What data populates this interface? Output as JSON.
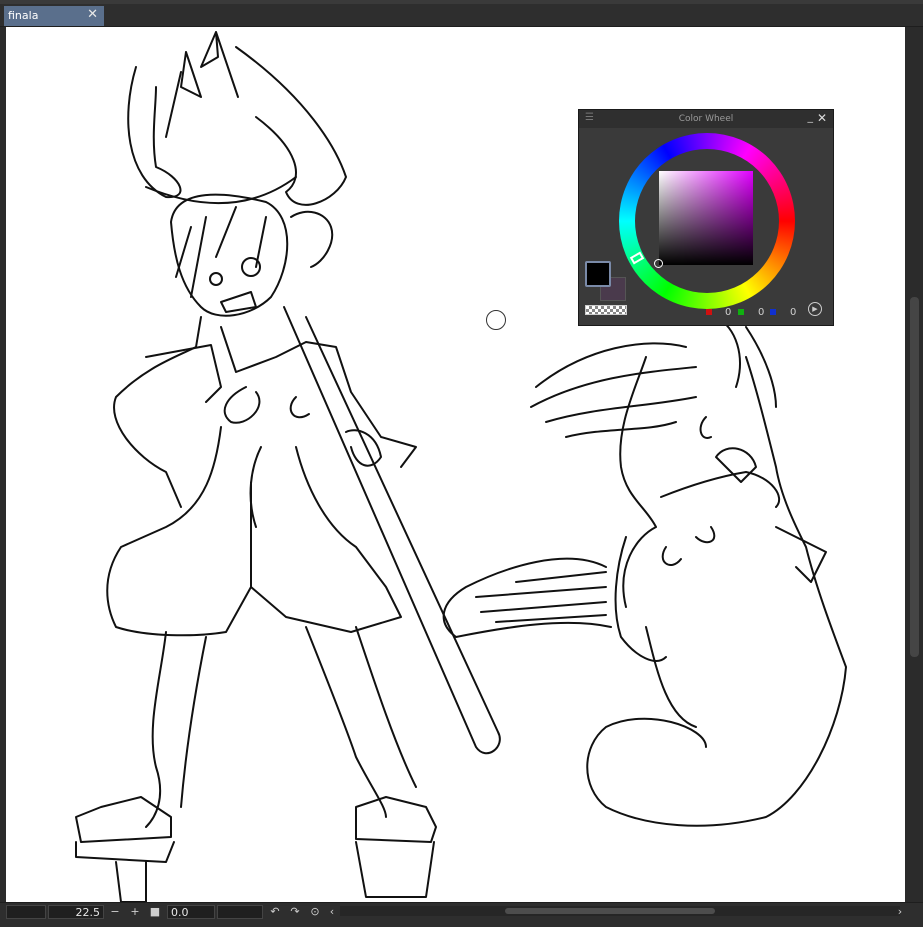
{
  "tab": {
    "title": "finala",
    "close_icon": "close-icon"
  },
  "colors": {
    "fg": "#000000",
    "bg": "#4a3a4c",
    "tab_active": "#5a6f8c"
  },
  "color_wheel": {
    "title": "Color Wheel",
    "r": "0",
    "g": "0",
    "b": "0"
  },
  "statusbar": {
    "zoom": "22.5",
    "rotation": "0.0"
  }
}
